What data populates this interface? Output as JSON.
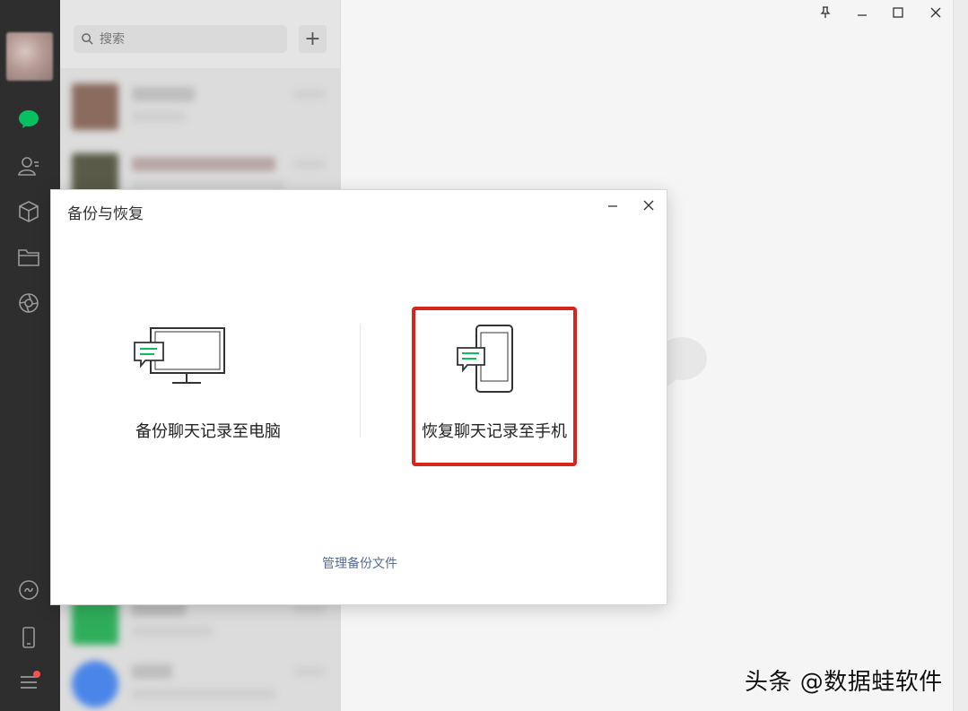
{
  "search": {
    "placeholder": "搜索"
  },
  "add_button": "+",
  "nav": {
    "icons": [
      "chat-icon",
      "contacts-icon",
      "favorites-icon",
      "files-icon",
      "moments-icon",
      "mini-programs-icon",
      "phone-icon",
      "menu-icon"
    ],
    "active_color": "#07c160"
  },
  "dialog": {
    "title": "备份与恢复",
    "backup_label": "备份聊天记录至电脑",
    "restore_label": "恢复聊天记录至手机",
    "manage_link": "管理备份文件",
    "highlight_color": "#d9231d"
  },
  "watermark": "头条 @数据蛙软件"
}
